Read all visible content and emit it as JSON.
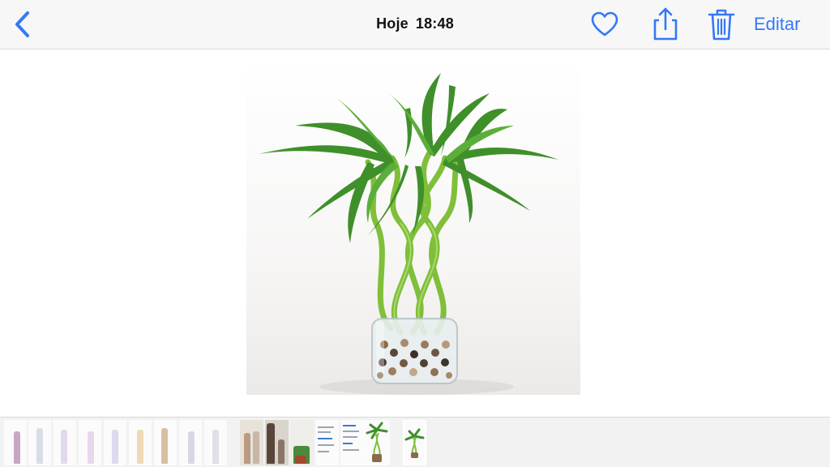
{
  "header": {
    "back_icon": "chevron-left-icon",
    "title_day": "Hoje",
    "title_time": "18:48",
    "favorite_icon": "heart-icon",
    "share_icon": "share-icon",
    "delete_icon": "trash-icon",
    "edit_label": "Editar",
    "accent_color": "#3478f6"
  },
  "photo": {
    "subject": "lucky bamboo braided in glass vase with pebbles"
  },
  "filmstrip": {
    "selected_index": 16,
    "thumbnail_count": 17
  }
}
